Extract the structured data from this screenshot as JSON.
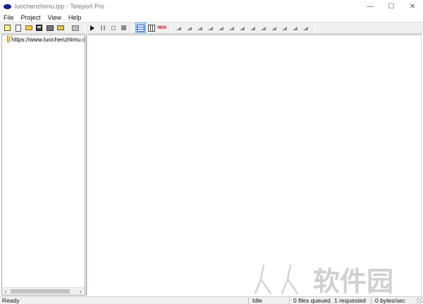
{
  "window": {
    "title": "luochenzhimu.tpp - Teleport Pro",
    "controls": {
      "minimize": "—",
      "maximize": "☐",
      "close": "✕"
    }
  },
  "menu": [
    "File",
    "Project",
    "View",
    "Help"
  ],
  "toolbar": {
    "icons": [
      "wizard-icon",
      "new-icon",
      "open-icon",
      "save-icon",
      "properties-icon",
      "folder-icon",
      "browse-icon",
      "play-icon",
      "pause-icon",
      "stop-gray-icon",
      "stop-icon",
      "list-view-icon",
      "details-view-icon",
      "new-files-icon",
      "signal-icon"
    ],
    "new_label": "NEW"
  },
  "tree": {
    "root_label": "https://www.luochenzhimu.c"
  },
  "scrollbar": {
    "left_arrow": "‹",
    "right_arrow": "›"
  },
  "status": {
    "state": "Ready",
    "activity": "Idle",
    "queued": "0 files queued",
    "requested": "1 requested",
    "rate": "0 bytes/sec"
  },
  "watermark": {
    "text": "人人软件园"
  },
  "colors": {
    "accent": "#1a1ea0",
    "toolbar_bg": "#f0f0f0",
    "watermark": "#d0d0d0"
  }
}
